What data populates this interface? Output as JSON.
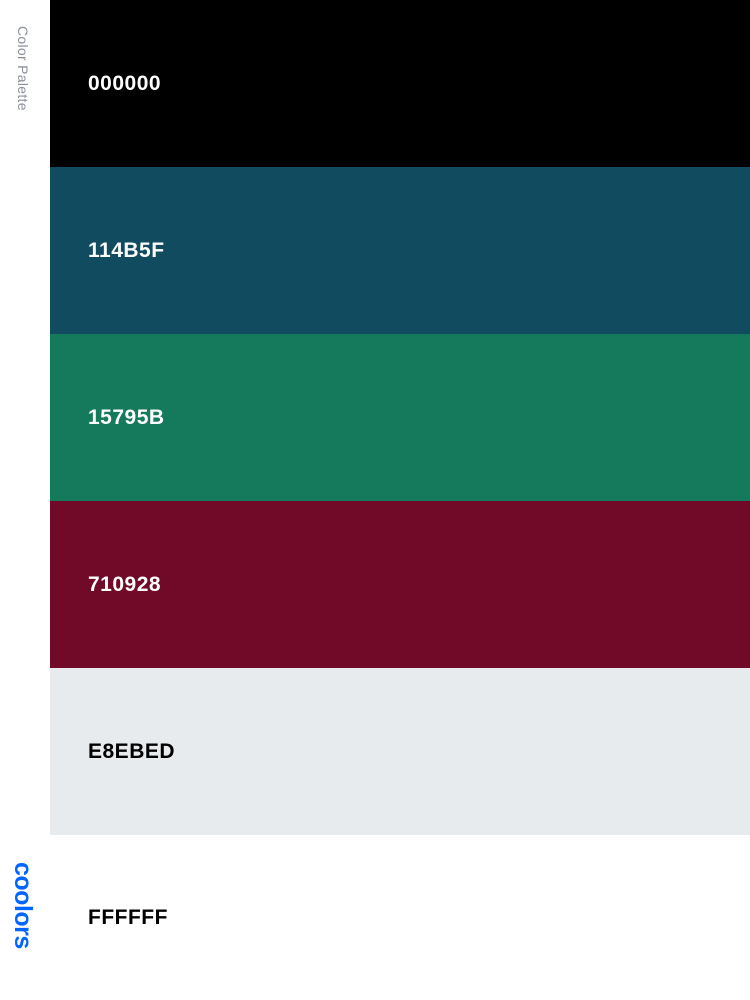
{
  "sidebar": {
    "title": "Color Palette",
    "logo": "coolors"
  },
  "palette": {
    "swatches": [
      {
        "hex": "000000",
        "color": "#000000",
        "text_color": "#ffffff"
      },
      {
        "hex": "114B5F",
        "color": "#114B5F",
        "text_color": "#ffffff"
      },
      {
        "hex": "15795B",
        "color": "#15795B",
        "text_color": "#ffffff"
      },
      {
        "hex": "710928",
        "color": "#710928",
        "text_color": "#ffffff"
      },
      {
        "hex": "E8EBED",
        "color": "#E8EBED",
        "text_color": "#000000"
      },
      {
        "hex": "FFFFFF",
        "color": "#FFFFFF",
        "text_color": "#000000"
      }
    ]
  },
  "colors": {
    "logo": "#0066ff",
    "sidebar_text": "#8a8f98"
  }
}
